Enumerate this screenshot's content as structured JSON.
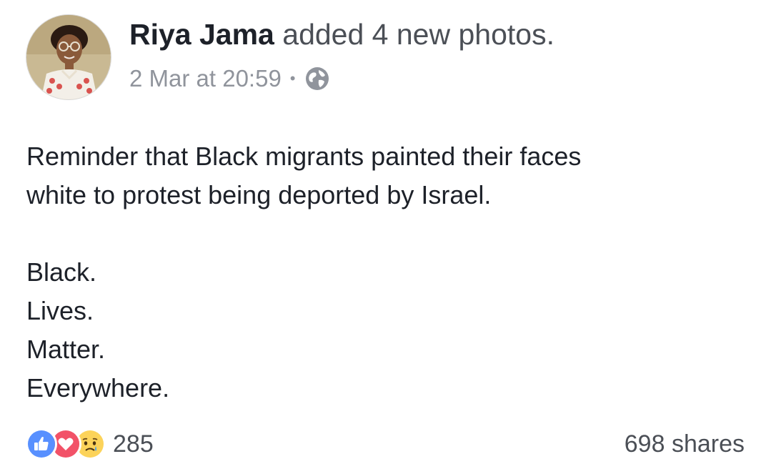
{
  "post": {
    "author_name": "Riya Jama",
    "action": "added 4 new photos.",
    "timestamp": "2 Mar at 20:59",
    "separator": "•",
    "privacy_icon": "globe-icon",
    "text_lines": [
      "Reminder that Black migrants painted their faces",
      "white to protest being deported by Israel."
    ],
    "text_stanza": [
      "Black.",
      "Lives.",
      "Matter.",
      "Everywhere."
    ],
    "reactions": {
      "icons": [
        "like-icon",
        "love-icon",
        "sad-icon"
      ],
      "count": "285"
    },
    "shares": "698 shares"
  },
  "colors": {
    "primary_text": "#1d2129",
    "secondary_text": "#90949c",
    "like_blue": "#5890ff",
    "love_red": "#f25268",
    "sad_yellow": "#fcd35a"
  }
}
